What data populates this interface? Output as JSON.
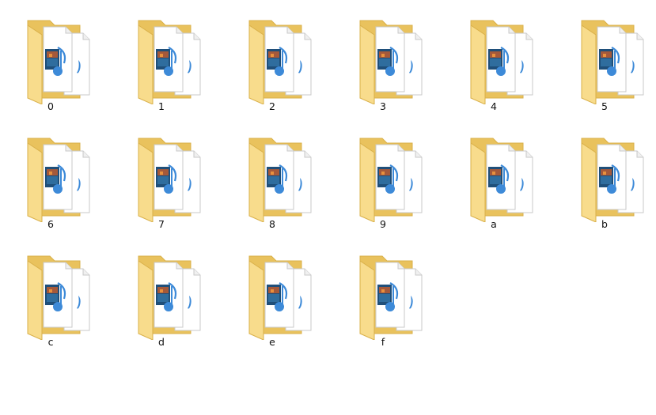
{
  "folders": [
    {
      "name": "0"
    },
    {
      "name": "1"
    },
    {
      "name": "2"
    },
    {
      "name": "3"
    },
    {
      "name": "4"
    },
    {
      "name": "5"
    },
    {
      "name": "6"
    },
    {
      "name": "7"
    },
    {
      "name": "8"
    },
    {
      "name": "9"
    },
    {
      "name": "a"
    },
    {
      "name": "b"
    },
    {
      "name": "c"
    },
    {
      "name": "d"
    },
    {
      "name": "e"
    },
    {
      "name": "f"
    }
  ],
  "icon": "folder-with-media-files-icon",
  "colors": {
    "folder_back": "#e9c25d",
    "folder_front": "#f8dc8c",
    "folder_edge": "#d9b04a",
    "page": "#ffffff",
    "page_border": "#c9c9c9",
    "music_note": "#3d8ad8",
    "video_frame": "#1f4f7a"
  }
}
